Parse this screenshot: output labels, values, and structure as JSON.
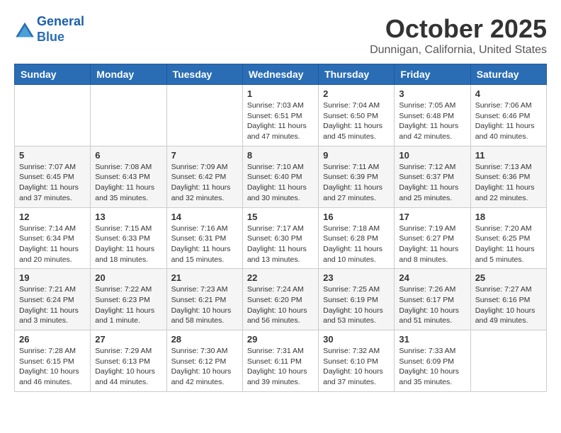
{
  "header": {
    "logo_line1": "General",
    "logo_line2": "Blue",
    "month_title": "October 2025",
    "location": "Dunnigan, California, United States"
  },
  "weekdays": [
    "Sunday",
    "Monday",
    "Tuesday",
    "Wednesday",
    "Thursday",
    "Friday",
    "Saturday"
  ],
  "weeks": [
    [
      {
        "day": "",
        "info": ""
      },
      {
        "day": "",
        "info": ""
      },
      {
        "day": "",
        "info": ""
      },
      {
        "day": "1",
        "info": "Sunrise: 7:03 AM\nSunset: 6:51 PM\nDaylight: 11 hours and 47 minutes."
      },
      {
        "day": "2",
        "info": "Sunrise: 7:04 AM\nSunset: 6:50 PM\nDaylight: 11 hours and 45 minutes."
      },
      {
        "day": "3",
        "info": "Sunrise: 7:05 AM\nSunset: 6:48 PM\nDaylight: 11 hours and 42 minutes."
      },
      {
        "day": "4",
        "info": "Sunrise: 7:06 AM\nSunset: 6:46 PM\nDaylight: 11 hours and 40 minutes."
      }
    ],
    [
      {
        "day": "5",
        "info": "Sunrise: 7:07 AM\nSunset: 6:45 PM\nDaylight: 11 hours and 37 minutes."
      },
      {
        "day": "6",
        "info": "Sunrise: 7:08 AM\nSunset: 6:43 PM\nDaylight: 11 hours and 35 minutes."
      },
      {
        "day": "7",
        "info": "Sunrise: 7:09 AM\nSunset: 6:42 PM\nDaylight: 11 hours and 32 minutes."
      },
      {
        "day": "8",
        "info": "Sunrise: 7:10 AM\nSunset: 6:40 PM\nDaylight: 11 hours and 30 minutes."
      },
      {
        "day": "9",
        "info": "Sunrise: 7:11 AM\nSunset: 6:39 PM\nDaylight: 11 hours and 27 minutes."
      },
      {
        "day": "10",
        "info": "Sunrise: 7:12 AM\nSunset: 6:37 PM\nDaylight: 11 hours and 25 minutes."
      },
      {
        "day": "11",
        "info": "Sunrise: 7:13 AM\nSunset: 6:36 PM\nDaylight: 11 hours and 22 minutes."
      }
    ],
    [
      {
        "day": "12",
        "info": "Sunrise: 7:14 AM\nSunset: 6:34 PM\nDaylight: 11 hours and 20 minutes."
      },
      {
        "day": "13",
        "info": "Sunrise: 7:15 AM\nSunset: 6:33 PM\nDaylight: 11 hours and 18 minutes."
      },
      {
        "day": "14",
        "info": "Sunrise: 7:16 AM\nSunset: 6:31 PM\nDaylight: 11 hours and 15 minutes."
      },
      {
        "day": "15",
        "info": "Sunrise: 7:17 AM\nSunset: 6:30 PM\nDaylight: 11 hours and 13 minutes."
      },
      {
        "day": "16",
        "info": "Sunrise: 7:18 AM\nSunset: 6:28 PM\nDaylight: 11 hours and 10 minutes."
      },
      {
        "day": "17",
        "info": "Sunrise: 7:19 AM\nSunset: 6:27 PM\nDaylight: 11 hours and 8 minutes."
      },
      {
        "day": "18",
        "info": "Sunrise: 7:20 AM\nSunset: 6:25 PM\nDaylight: 11 hours and 5 minutes."
      }
    ],
    [
      {
        "day": "19",
        "info": "Sunrise: 7:21 AM\nSunset: 6:24 PM\nDaylight: 11 hours and 3 minutes."
      },
      {
        "day": "20",
        "info": "Sunrise: 7:22 AM\nSunset: 6:23 PM\nDaylight: 11 hours and 1 minute."
      },
      {
        "day": "21",
        "info": "Sunrise: 7:23 AM\nSunset: 6:21 PM\nDaylight: 10 hours and 58 minutes."
      },
      {
        "day": "22",
        "info": "Sunrise: 7:24 AM\nSunset: 6:20 PM\nDaylight: 10 hours and 56 minutes."
      },
      {
        "day": "23",
        "info": "Sunrise: 7:25 AM\nSunset: 6:19 PM\nDaylight: 10 hours and 53 minutes."
      },
      {
        "day": "24",
        "info": "Sunrise: 7:26 AM\nSunset: 6:17 PM\nDaylight: 10 hours and 51 minutes."
      },
      {
        "day": "25",
        "info": "Sunrise: 7:27 AM\nSunset: 6:16 PM\nDaylight: 10 hours and 49 minutes."
      }
    ],
    [
      {
        "day": "26",
        "info": "Sunrise: 7:28 AM\nSunset: 6:15 PM\nDaylight: 10 hours and 46 minutes."
      },
      {
        "day": "27",
        "info": "Sunrise: 7:29 AM\nSunset: 6:13 PM\nDaylight: 10 hours and 44 minutes."
      },
      {
        "day": "28",
        "info": "Sunrise: 7:30 AM\nSunset: 6:12 PM\nDaylight: 10 hours and 42 minutes."
      },
      {
        "day": "29",
        "info": "Sunrise: 7:31 AM\nSunset: 6:11 PM\nDaylight: 10 hours and 39 minutes."
      },
      {
        "day": "30",
        "info": "Sunrise: 7:32 AM\nSunset: 6:10 PM\nDaylight: 10 hours and 37 minutes."
      },
      {
        "day": "31",
        "info": "Sunrise: 7:33 AM\nSunset: 6:09 PM\nDaylight: 10 hours and 35 minutes."
      },
      {
        "day": "",
        "info": ""
      }
    ]
  ]
}
